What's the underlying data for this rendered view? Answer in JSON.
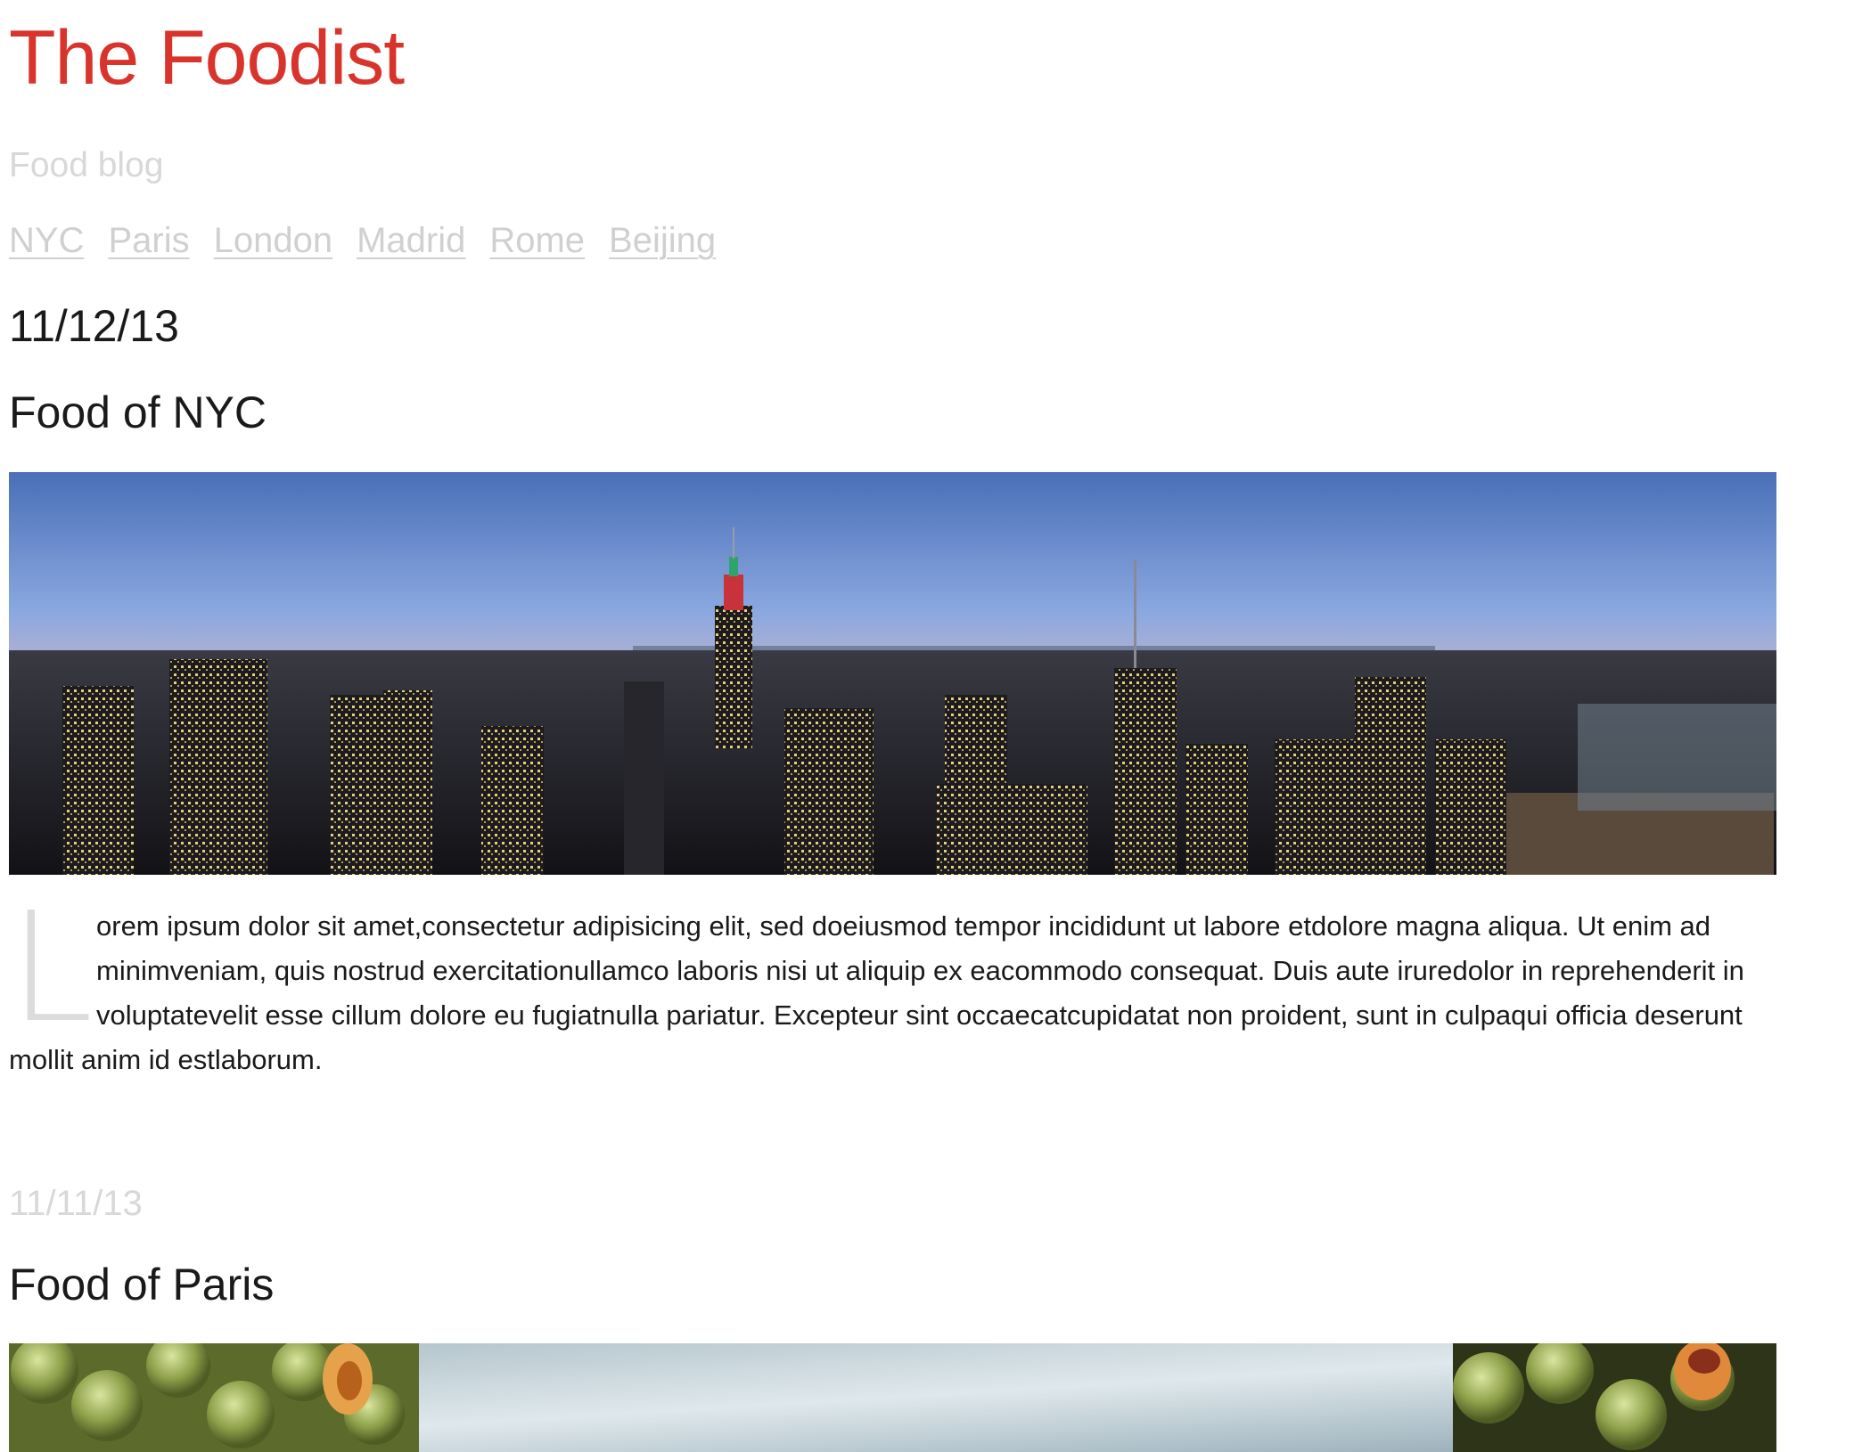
{
  "site": {
    "title": "The Foodist",
    "tagline": "Food blog"
  },
  "nav": {
    "items": [
      "NYC",
      "Paris",
      "London",
      "Madrid",
      "Rome",
      "Beijing"
    ]
  },
  "posts": [
    {
      "date": "11/12/13",
      "title": "Food of NYC",
      "image": "nyc-skyline-panorama",
      "drop_cap": "L",
      "body": "orem ipsum dolor sit amet,consectetur adipisicing elit, sed doeiusmod tempor incididunt ut labore etdolore magna aliqua. Ut enim ad minimveniam, quis nostrud exercitationullamco laboris nisi ut aliquip ex eacommodo consequat. Duis aute iruredolor in reprehenderit in voluptatevelit esse cillum dolore eu fugiatnulla pariatur. Excepteur sint occaecatcupidatat non proident, sunt in culpaqui officia deserunt mollit anim id estlaborum."
    },
    {
      "date": "11/11/13",
      "title": "Food of Paris",
      "image": "grapes-and-sky-photo"
    }
  ],
  "colors": {
    "brand": "#d9342b",
    "muted": "#d8d8d8",
    "text": "#1a1a1a"
  }
}
